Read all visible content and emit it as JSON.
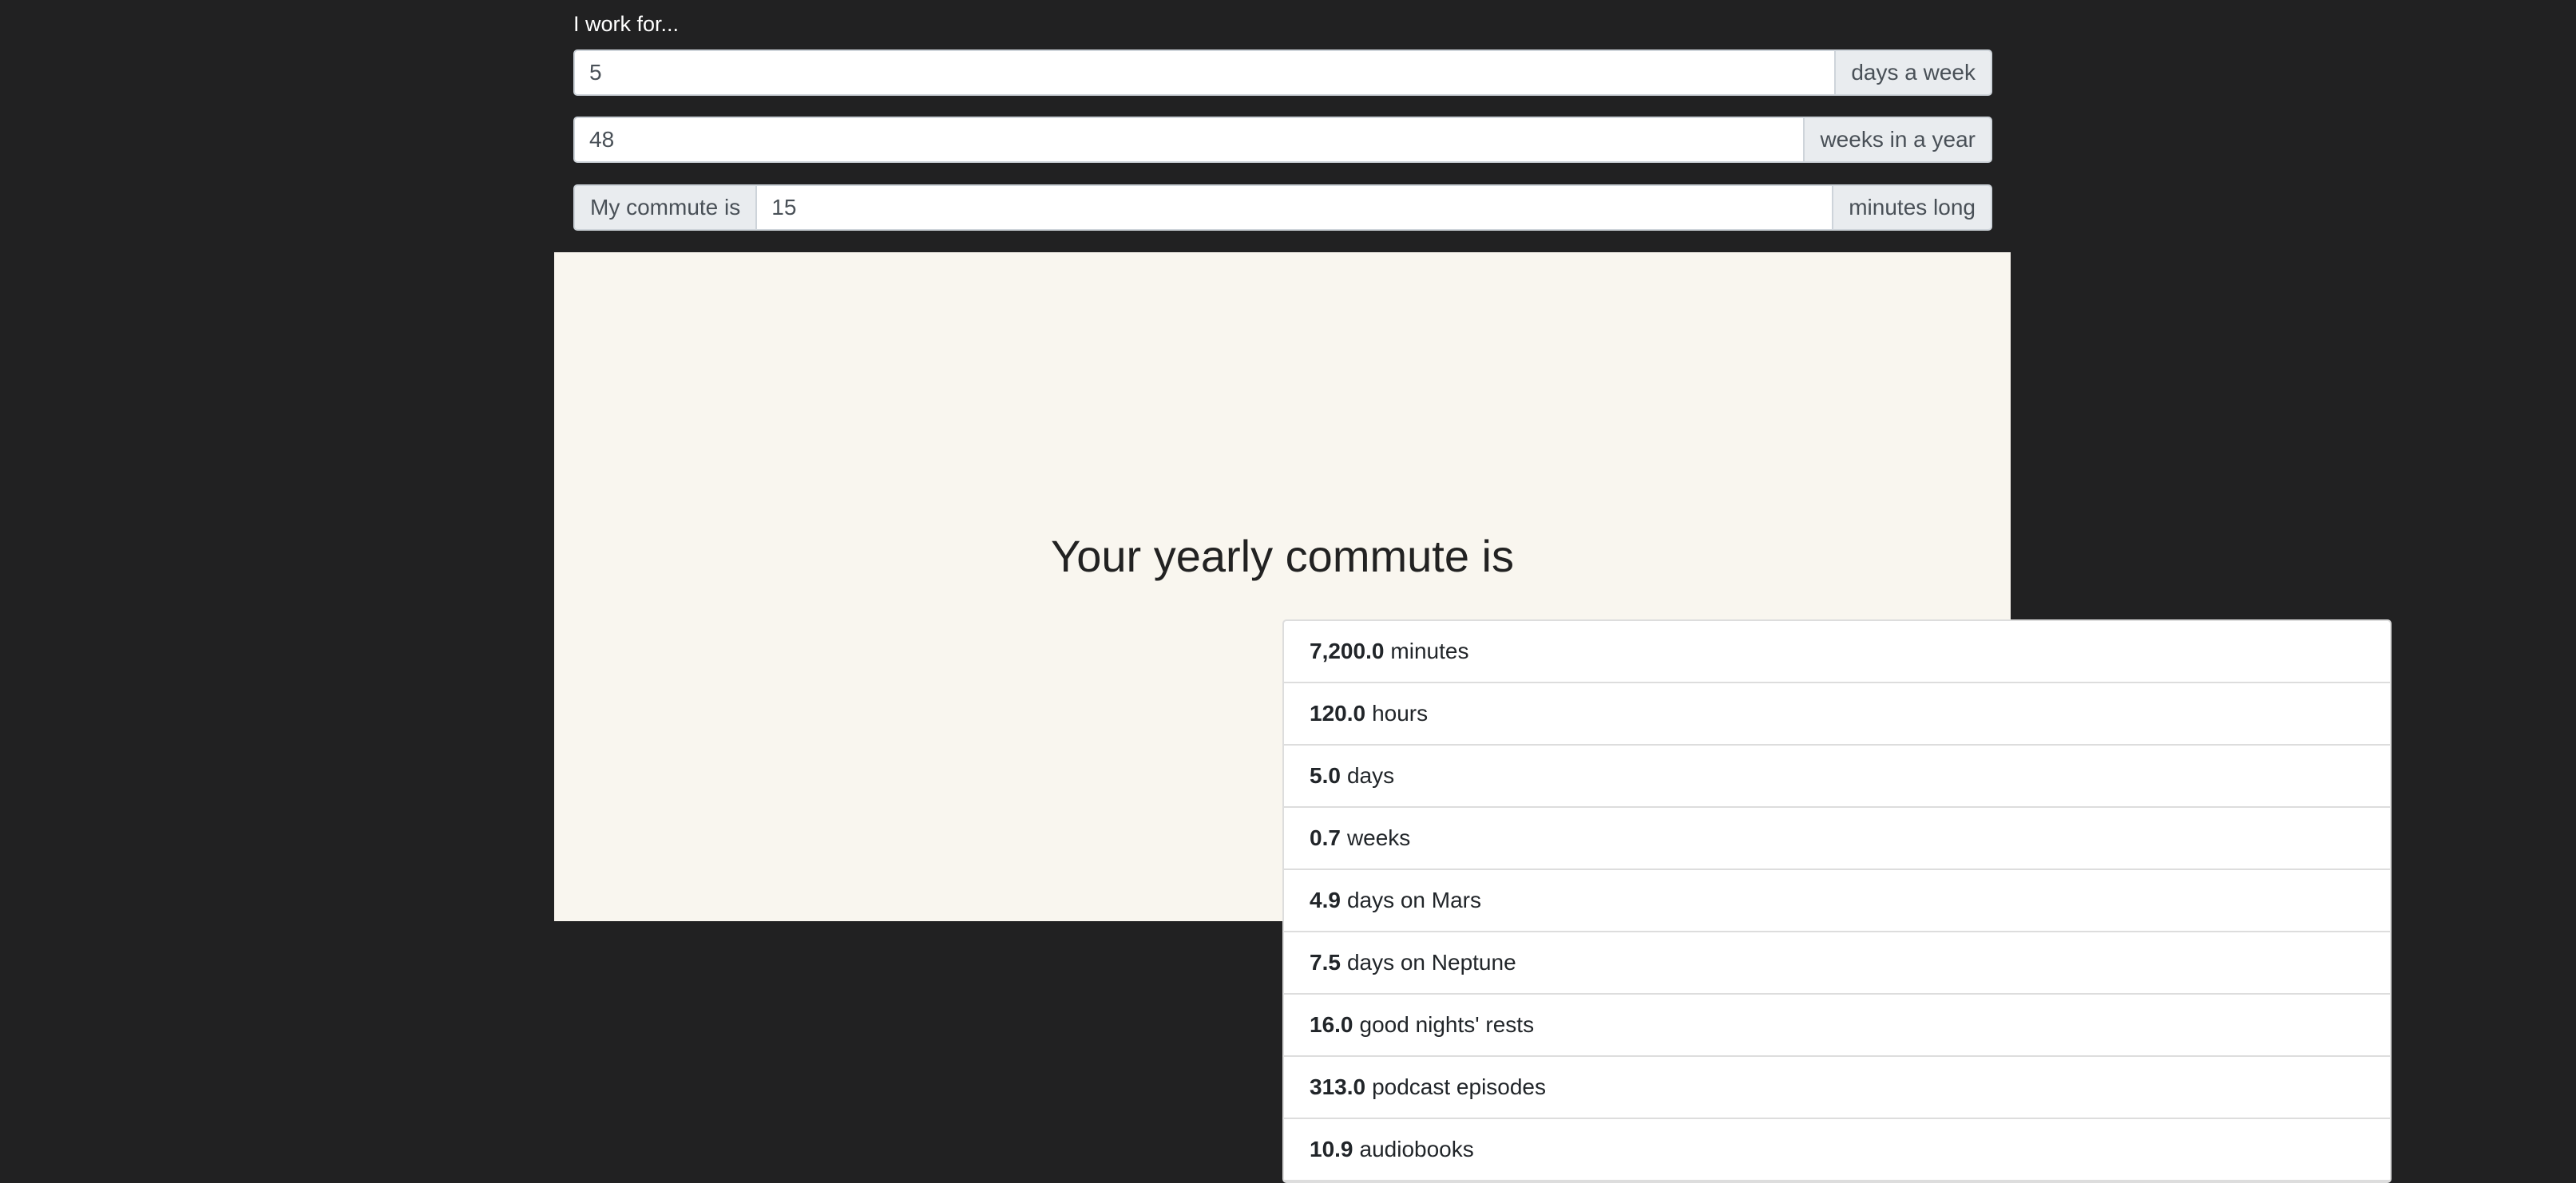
{
  "form": {
    "intro": "I work for...",
    "days_per_week": {
      "value": "5",
      "suffix": "days a week"
    },
    "weeks_per_year": {
      "value": "48",
      "suffix": "weeks in a year"
    },
    "commute": {
      "prefix": "My commute is",
      "value": "15",
      "suffix": "minutes long"
    }
  },
  "results": {
    "title": "Your yearly commute is",
    "items": [
      {
        "value": "7,200.0",
        "unit": "minutes"
      },
      {
        "value": "120.0",
        "unit": "hours"
      },
      {
        "value": "5.0",
        "unit": "days"
      },
      {
        "value": "0.7",
        "unit": "weeks"
      },
      {
        "value": "4.9",
        "unit": "days on Mars"
      },
      {
        "value": "7.5",
        "unit": "days on Neptune"
      },
      {
        "value": "16.0",
        "unit": "good nights' rests"
      },
      {
        "value": "313.0",
        "unit": "podcast episodes"
      },
      {
        "value": "10.9",
        "unit": "audiobooks"
      }
    ]
  }
}
